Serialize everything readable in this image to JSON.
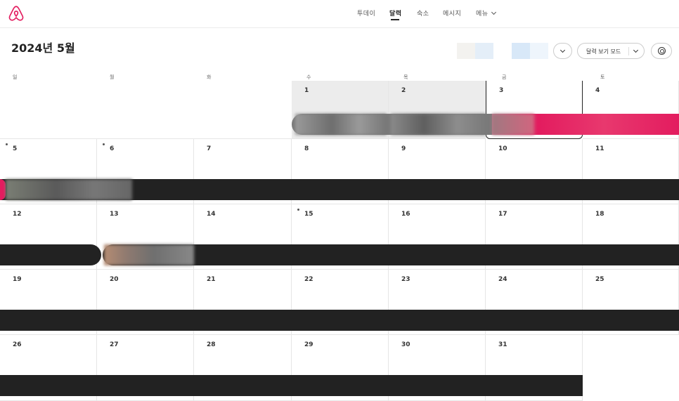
{
  "nav": {
    "today": "투데이",
    "calendar": "달력",
    "listings": "숙소",
    "messages": "메시지",
    "menu": "메뉴"
  },
  "month_title": "2024년 5월",
  "controls": {
    "view_mode_label": "달력 보기 모드"
  },
  "weekdays": [
    "일",
    "월",
    "화",
    "수",
    "목",
    "금",
    "토"
  ],
  "weeks": [
    [
      "",
      "",
      "",
      "1",
      "2",
      "3",
      "4"
    ],
    [
      "5",
      "6",
      "7",
      "8",
      "9",
      "10",
      "11"
    ],
    [
      "12",
      "13",
      "14",
      "15",
      "16",
      "17",
      "18"
    ],
    [
      "19",
      "20",
      "21",
      "22",
      "23",
      "24",
      "25"
    ],
    [
      "26",
      "27",
      "28",
      "29",
      "30",
      "31",
      ""
    ]
  ],
  "today_date": "3",
  "colors": {
    "brand": "#E31C5F",
    "booking_bar": "#222222",
    "past_day": "#ECECEC",
    "listing_swatches": [
      "#f3f2ef",
      "#e4eef8",
      "#d8e8f8",
      "#eef5fc",
      "#ffffff"
    ]
  },
  "icons": {
    "logo": "airbnb-logo-icon",
    "select_chevron": "chevron-down-icon",
    "settings": "settings-ring-icon"
  }
}
